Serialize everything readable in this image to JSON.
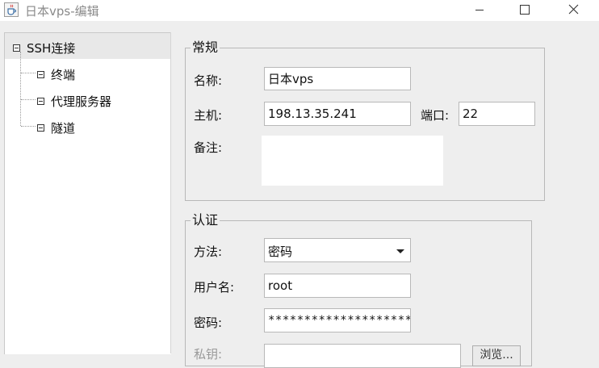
{
  "window": {
    "title": "日本vps-编辑",
    "minimize_icon": "minimize-icon",
    "maximize_icon": "maximize-icon",
    "close_icon": "close-icon",
    "app_icon": "java-cup-icon"
  },
  "tree": {
    "root": {
      "label": "SSH连接",
      "expanded": true,
      "selected": true
    },
    "children": [
      {
        "label": "终端"
      },
      {
        "label": "代理服务器"
      },
      {
        "label": "隧道"
      }
    ]
  },
  "general": {
    "legend": "常规",
    "name_label": "名称:",
    "name_value": "日本vps",
    "host_label": "主机:",
    "host_value": "198.13.35.241",
    "port_label": "端口:",
    "port_value": "22",
    "note_label": "备注:",
    "note_value": ""
  },
  "auth": {
    "legend": "认证",
    "method_label": "方法:",
    "method_value": "密码",
    "username_label": "用户名:",
    "username_value": "root",
    "password_label": "密码:",
    "password_value": "**********************",
    "key_label": "私钥:",
    "browse_label": "浏览..."
  }
}
